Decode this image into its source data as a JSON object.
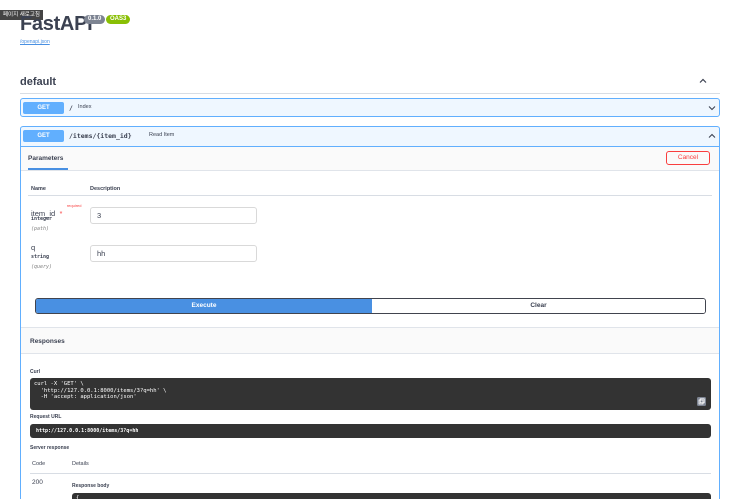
{
  "browser": {
    "refresh_tag": "페이지 새로고침"
  },
  "header": {
    "title": "FastAPI",
    "version_badge": "0.1.0",
    "oas_badge": "OAS3",
    "openapi_link": "/openapi.json"
  },
  "section": {
    "title": "default"
  },
  "operations": [
    {
      "method": "GET",
      "path": "/",
      "summary": "Index"
    },
    {
      "method": "GET",
      "path": "/items/{item_id}",
      "summary": "Read Item"
    }
  ],
  "params": {
    "tab_label": "Parameters",
    "cancel_label": "Cancel",
    "col_name": "Name",
    "col_description": "Description",
    "items": [
      {
        "name": "item_id",
        "required_star": "*",
        "required_text": "required",
        "type": "integer",
        "in": "(path)",
        "value": "3"
      },
      {
        "name": "q",
        "type": "string",
        "in": "(query)",
        "value": "hh"
      }
    ]
  },
  "actions": {
    "execute_label": "Execute",
    "clear_label": "Clear"
  },
  "responses": {
    "title": "Responses",
    "curl_label": "Curl",
    "curl_text": "curl -X 'GET' \\\n  'http://127.0.0.1:8000/items/3?q=hh' \\\n  -H 'accept: application/json'",
    "request_url_label": "Request URL",
    "request_url": "http://127.0.0.1:8000/items/3?q=hh",
    "server_response_label": "Server response",
    "col_code": "Code",
    "col_details": "Details",
    "code": "200",
    "body_label": "Response body",
    "body_first_line": "{"
  },
  "colors": {
    "get": "#61affe",
    "execute": "#4990e2",
    "cancel": "#f93e3e",
    "oas": "#89bf04"
  }
}
